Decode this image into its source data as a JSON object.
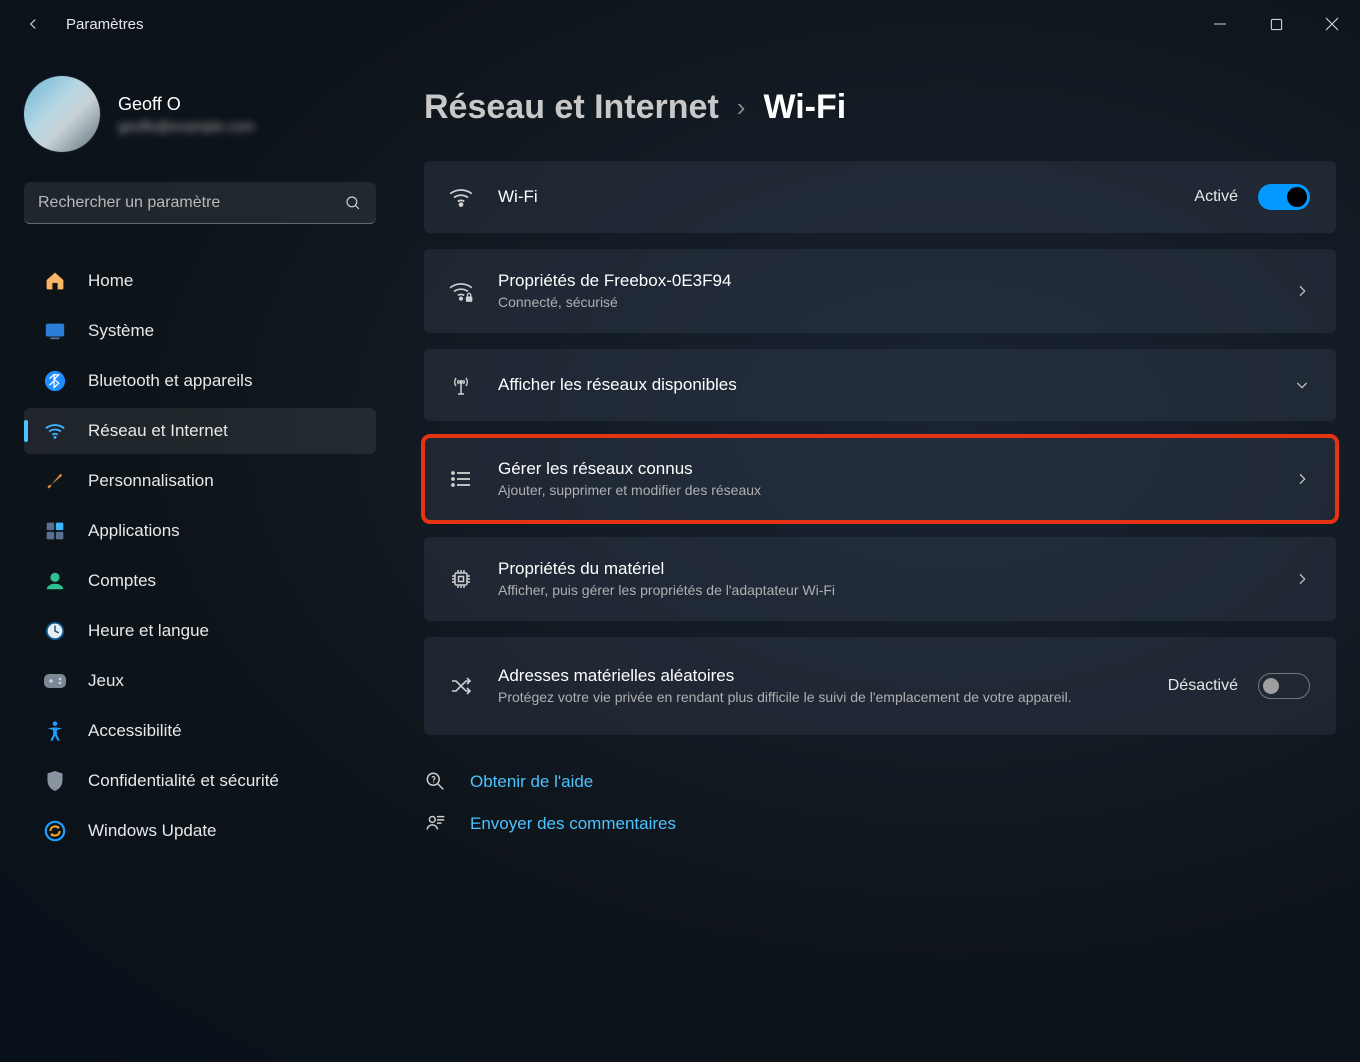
{
  "titlebar": {
    "title": "Paramètres"
  },
  "profile": {
    "name": "Geoff O",
    "email": "geoffo@example.com"
  },
  "search": {
    "placeholder": "Rechercher un paramètre"
  },
  "sidebar": {
    "items": [
      {
        "label": "Home"
      },
      {
        "label": "Système"
      },
      {
        "label": "Bluetooth et appareils"
      },
      {
        "label": "Réseau et Internet"
      },
      {
        "label": "Personnalisation"
      },
      {
        "label": "Applications"
      },
      {
        "label": "Comptes"
      },
      {
        "label": "Heure et langue"
      },
      {
        "label": "Jeux"
      },
      {
        "label": "Accessibilité"
      },
      {
        "label": "Confidentialité et sécurité"
      },
      {
        "label": "Windows Update"
      }
    ]
  },
  "breadcrumb": {
    "parent": "Réseau et Internet",
    "sep": "›",
    "current": "Wi-Fi"
  },
  "cards": {
    "wifi": {
      "title": "Wi-Fi",
      "status": "Activé",
      "on": true
    },
    "props": {
      "title": "Propriétés de Freebox-0E3F94",
      "sub": "Connecté, sécurisé"
    },
    "show": {
      "title": "Afficher les réseaux disponibles"
    },
    "manage": {
      "title": "Gérer les réseaux connus",
      "sub": "Ajouter, supprimer et modifier des réseaux"
    },
    "hw": {
      "title": "Propriétés du matériel",
      "sub": "Afficher, puis gérer les propriétés de l'adaptateur Wi-Fi"
    },
    "mac": {
      "title": "Adresses matérielles aléatoires",
      "sub": "Protégez votre vie privée en rendant plus difficile le suivi de l'emplacement de votre appareil.",
      "status": "Désactivé",
      "on": false
    }
  },
  "links": {
    "help": "Obtenir de l'aide",
    "feedback": "Envoyer des commentaires"
  }
}
